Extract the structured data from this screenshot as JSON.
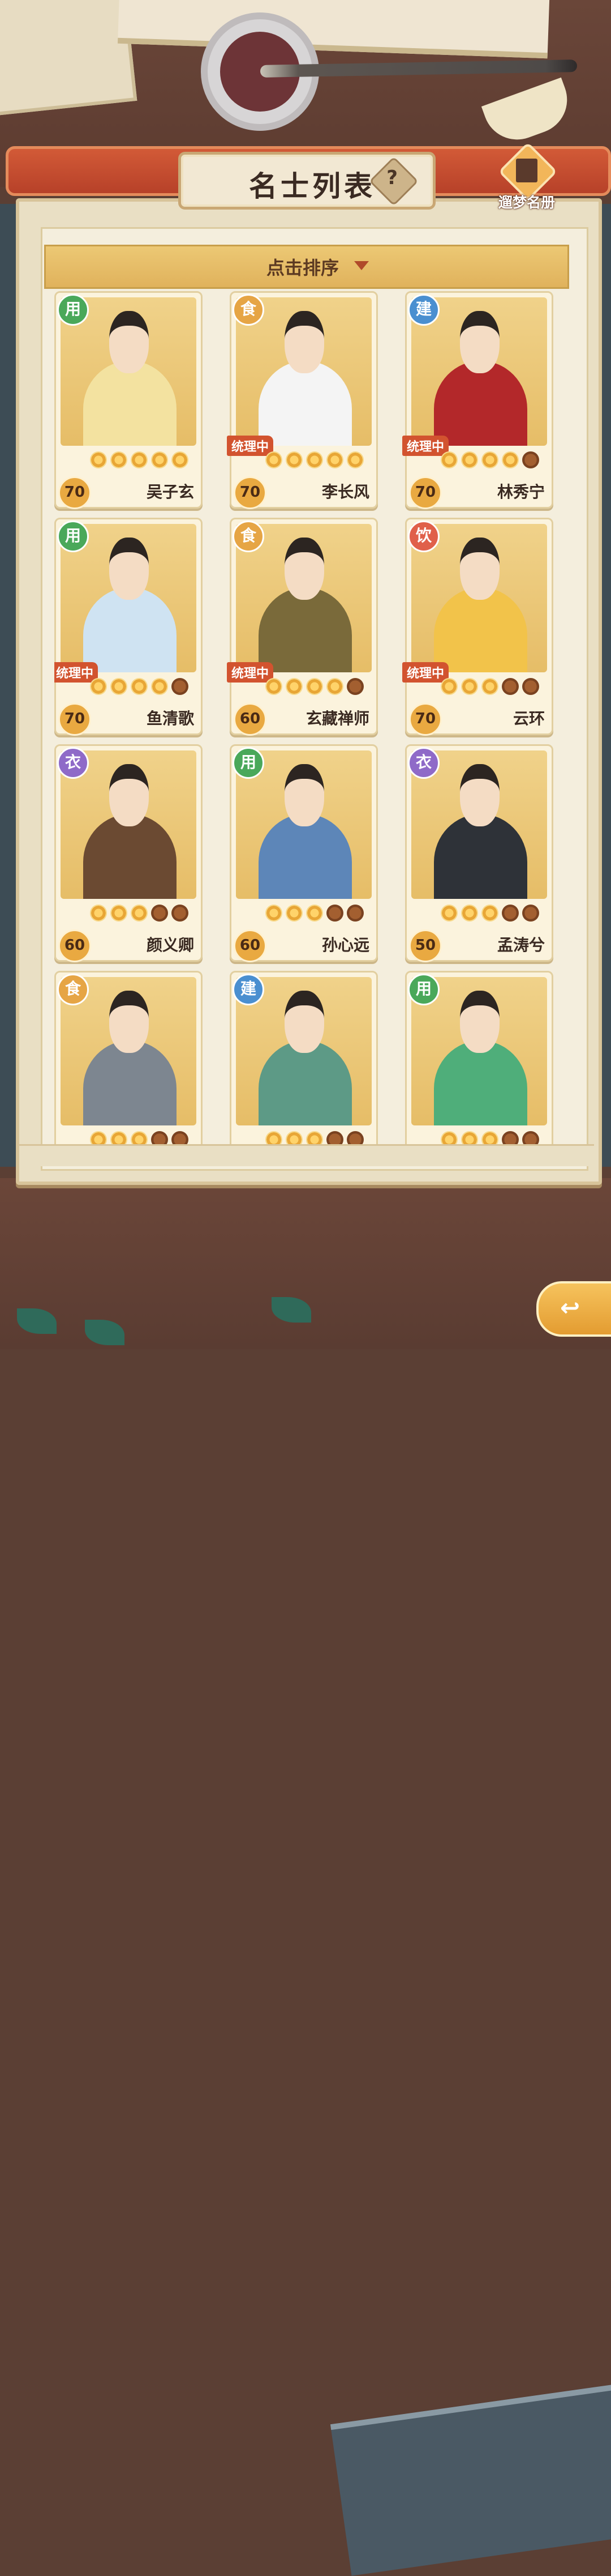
{
  "header": {
    "title": "名士列表",
    "help_label": "?",
    "codex_label": "遛梦名册"
  },
  "sort": {
    "label": "点击排序"
  },
  "badge_colors": {
    "用": "#4aa85a",
    "食": "#e6a545",
    "建": "#4a8fd0",
    "饮": "#e0604a",
    "衣": "#8f6ac8"
  },
  "cards": [
    {
      "category": "用",
      "level": "70",
      "name": "吴子玄",
      "stars": 5,
      "stars_max": 5,
      "managing": "",
      "robe": "#f3e2a0"
    },
    {
      "category": "食",
      "level": "70",
      "name": "李长风",
      "stars": 5,
      "stars_max": 5,
      "managing": "统理中",
      "robe": "#f4f4f4"
    },
    {
      "category": "建",
      "level": "70",
      "name": "林秀宁",
      "stars": 4,
      "stars_max": 5,
      "managing": "统理中",
      "robe": "#b3282a"
    },
    {
      "category": "用",
      "level": "70",
      "name": "鱼清歌",
      "stars": 4,
      "stars_max": 5,
      "managing": "统理中",
      "robe": "#cfe3f2"
    },
    {
      "category": "食",
      "level": "60",
      "name": "玄藏禅师",
      "stars": 4,
      "stars_max": 5,
      "managing": "统理中",
      "robe": "#7a6a3a"
    },
    {
      "category": "饮",
      "level": "70",
      "name": "云环",
      "stars": 3,
      "stars_max": 5,
      "managing": "统理中",
      "robe": "#f2c34a"
    },
    {
      "category": "衣",
      "level": "60",
      "name": "颜义卿",
      "stars": 3,
      "stars_max": 5,
      "managing": "",
      "robe": "#6b4a32"
    },
    {
      "category": "用",
      "level": "60",
      "name": "孙心远",
      "stars": 3,
      "stars_max": 5,
      "managing": "",
      "robe": "#5d86b8"
    },
    {
      "category": "衣",
      "level": "50",
      "name": "孟涛兮",
      "stars": 3,
      "stars_max": 5,
      "managing": "",
      "robe": "#2e3238"
    },
    {
      "category": "食",
      "level": "",
      "name": "",
      "stars": 3,
      "stars_max": 5,
      "managing": "",
      "robe": "#7d8690"
    },
    {
      "category": "建",
      "level": "",
      "name": "",
      "stars": 3,
      "stars_max": 5,
      "managing": "",
      "robe": "#5d9a86"
    },
    {
      "category": "用",
      "level": "",
      "name": "",
      "stars": 3,
      "stars_max": 5,
      "managing": "",
      "robe": "#4fae7a"
    }
  ],
  "back_button": {
    "icon": "return-arrow-icon",
    "glyph": "↩"
  }
}
